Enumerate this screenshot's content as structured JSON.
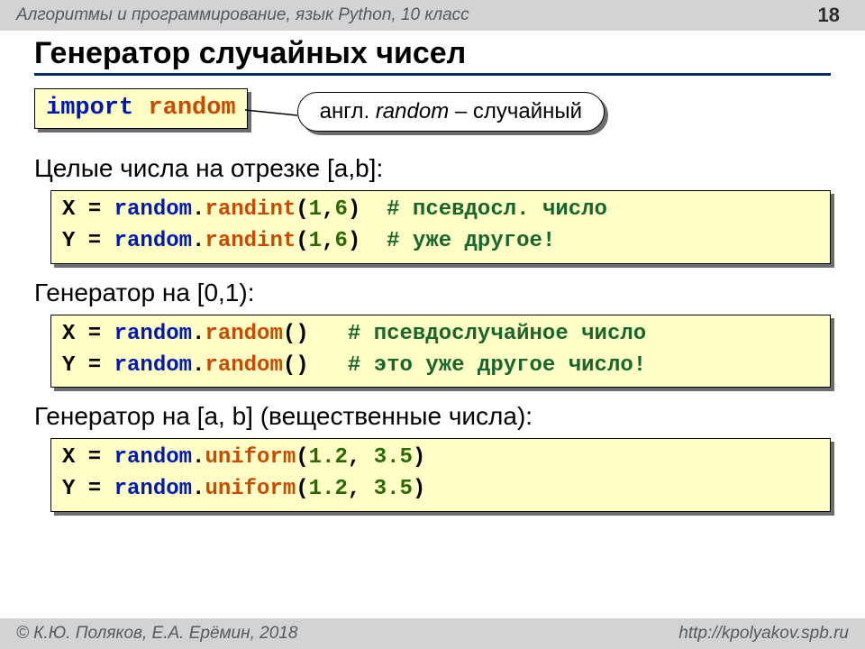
{
  "header": {
    "course": "Алгоритмы и программирование, язык Python, 10 класс",
    "page": "18"
  },
  "title": "Генератор случайных чисел",
  "import_line": {
    "kw": "import",
    "mod": "random"
  },
  "callout": {
    "pre": "англ. ",
    "word": "random",
    "post": " – случайный"
  },
  "sec1": "Целые числа на отрезке [a,b]:",
  "code1": {
    "l1": {
      "pre": "X = ",
      "mod": "random",
      "dot": ".",
      "fn": "randint",
      "op": "(",
      "n1": "1",
      "c": ",",
      "n2": "6",
      "cp": ")",
      "sp": "  ",
      "cmt": "# псевдосл. число"
    },
    "l2": {
      "pre": "Y = ",
      "mod": "random",
      "dot": ".",
      "fn": "randint",
      "op": "(",
      "n1": "1",
      "c": ",",
      "n2": "6",
      "cp": ")",
      "sp": "  ",
      "cmt": "# уже другое!"
    }
  },
  "sec2": "Генератор на [0,1):",
  "code2": {
    "l1": {
      "pre": "X = ",
      "mod": "random",
      "dot": ".",
      "fn": "random",
      "par": "()",
      "sp": "   ",
      "cmt": "# псевдослучайное число"
    },
    "l2": {
      "pre": "Y = ",
      "mod": "random",
      "dot": ".",
      "fn": "random",
      "par": "()",
      "sp": "   ",
      "cmt": "# это уже другое число!"
    }
  },
  "sec3": "Генератор на [a, b] (вещественные числа):",
  "code3": {
    "l1": {
      "pre": "X = ",
      "mod": "random",
      "dot": ".",
      "fn": "uniform",
      "op": "(",
      "n1": "1.2",
      "c": ", ",
      "n2": "3.5",
      "cp": ")"
    },
    "l2": {
      "pre": "Y = ",
      "mod": "random",
      "dot": ".",
      "fn": "uniform",
      "op": "(",
      "n1": "1.2",
      "c": ", ",
      "n2": "3.5",
      "cp": ")"
    }
  },
  "footer": {
    "left": "© К.Ю. Поляков, Е.А. Ерёмин, 2018",
    "right": "http://kpolyakov.spb.ru"
  }
}
